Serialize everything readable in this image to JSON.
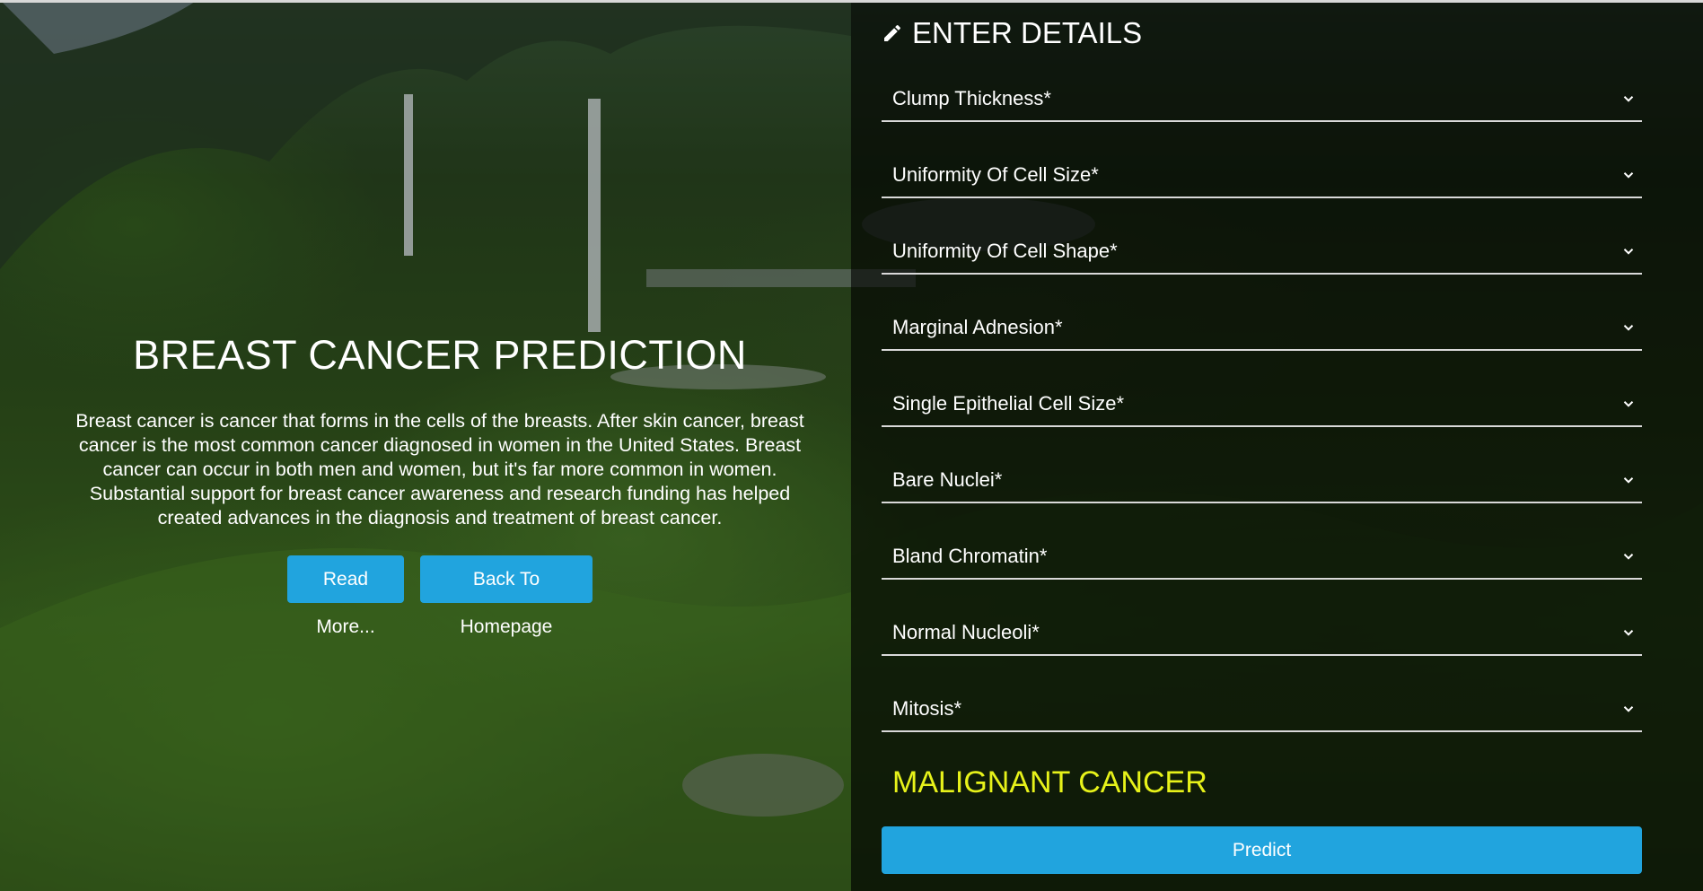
{
  "hero": {
    "title": "BREAST CANCER PREDICTION",
    "description": "Breast cancer is cancer that forms in the cells of the breasts. After skin cancer, breast cancer is the most common cancer diagnosed in women in the United States. Breast cancer can occur in both men and women, but it's far more common in women. Substantial support for breast cancer awareness and research funding has helped created advances in the diagnosis and treatment of breast cancer.",
    "read_more_label": "Read More...",
    "homepage_label": "Back To Homepage"
  },
  "form": {
    "title": "ENTER DETAILS",
    "title_icon": "pencil-icon",
    "fields": [
      {
        "label": "Clump Thickness*"
      },
      {
        "label": "Uniformity Of Cell Size*"
      },
      {
        "label": "Uniformity Of Cell Shape*"
      },
      {
        "label": "Marginal Adnesion*"
      },
      {
        "label": "Single Epithelial Cell Size*"
      },
      {
        "label": "Bare Nuclei*"
      },
      {
        "label": "Bland Chromatin*"
      },
      {
        "label": "Normal Nucleoli*"
      },
      {
        "label": "Mitosis*"
      }
    ],
    "dropdown_icon": "chevron-down-icon",
    "result": "MALIGNANT CANCER",
    "predict_label": "Predict"
  },
  "colors": {
    "accent": "#21a4de",
    "result": "#e7f21a",
    "text": "#ffffff"
  }
}
